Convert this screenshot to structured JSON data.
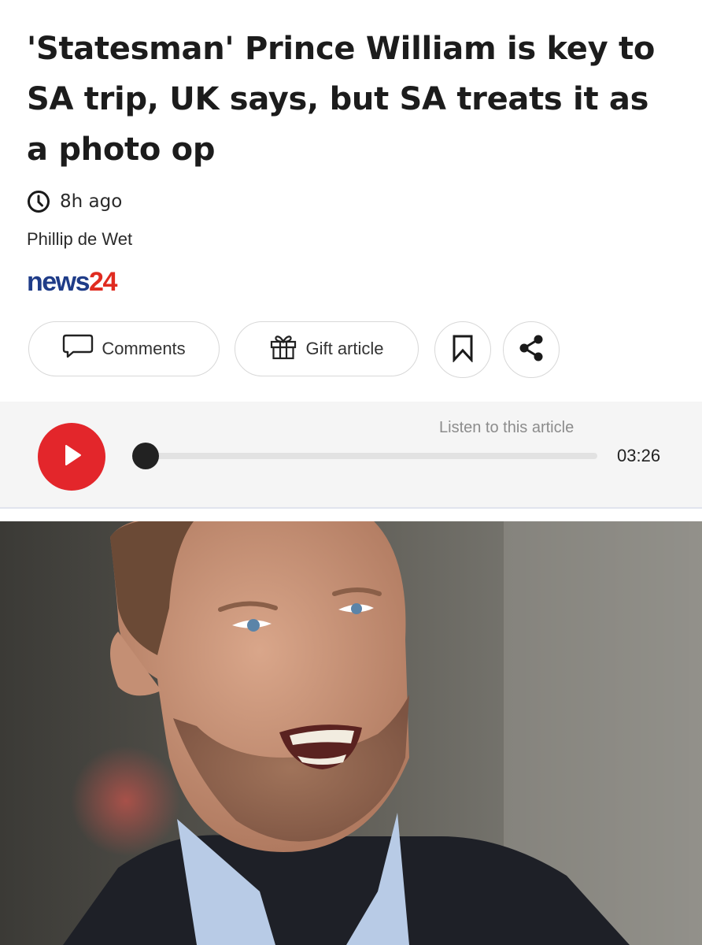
{
  "article": {
    "headline": "'Statesman' Prince William is key to SA trip, UK says, but SA treats it as a photo op",
    "time_ago": "8h ago",
    "author": "Phillip de Wet"
  },
  "brand": {
    "part1": "news",
    "part2": "24",
    "color_primary": "#1f3c88",
    "color_accent": "#e02b20"
  },
  "actions": {
    "comments_label": "Comments",
    "gift_label": "Gift article",
    "comments_icon": "speech-bubble-icon",
    "gift_icon": "gift-icon",
    "bookmark_icon": "bookmark-icon",
    "share_icon": "share-icon"
  },
  "audio": {
    "listen_label": "Listen to this article",
    "duration": "03:26",
    "progress": 0,
    "play_color": "#e3262b"
  },
  "hero_image": {
    "alt": "Prince William"
  }
}
